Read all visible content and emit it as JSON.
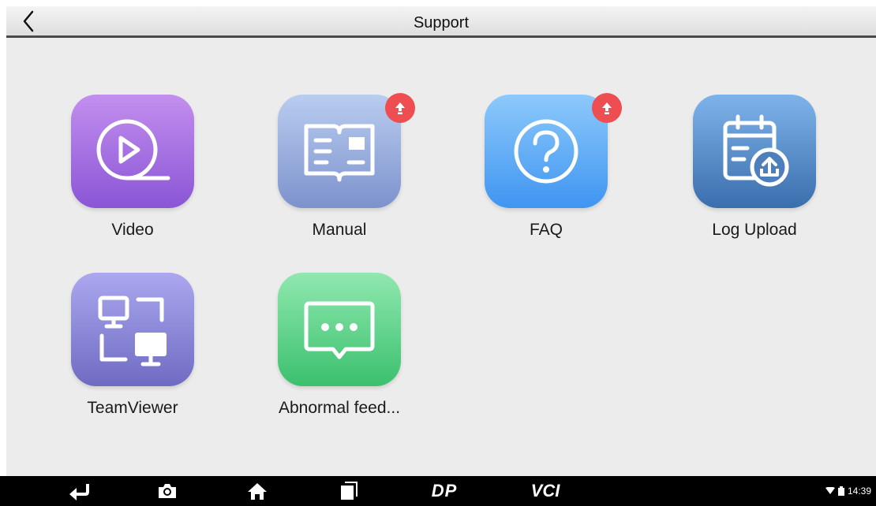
{
  "header": {
    "title": "Support",
    "back_icon": "chevron-left-icon"
  },
  "tiles": [
    {
      "label": "Video",
      "icon": "play-video-icon",
      "colors": [
        "#c38fee",
        "#8a55d6"
      ],
      "badge": false
    },
    {
      "label": "Manual",
      "icon": "manual-book-icon",
      "colors": [
        "#b9cdf0",
        "#7d92cc"
      ],
      "badge": true
    },
    {
      "label": "FAQ",
      "icon": "question-icon",
      "colors": [
        "#8dc9fb",
        "#3f95f1"
      ],
      "badge": true
    },
    {
      "label": "Log Upload",
      "icon": "log-upload-icon",
      "colors": [
        "#7eb3ea",
        "#3a6ead"
      ],
      "badge": false
    },
    {
      "label": "TeamViewer",
      "icon": "teamviewer-icon",
      "colors": [
        "#aba8ef",
        "#6f6bc2"
      ],
      "badge": false
    },
    {
      "label": "Abnormal feed...",
      "icon": "feedback-chat-icon",
      "colors": [
        "#90e8af",
        "#3bc06e"
      ],
      "badge": false
    }
  ],
  "badge": {
    "icon": "update-arrow-icon",
    "color": "#ee4d52"
  },
  "navbar": {
    "buttons": [
      "back-nav-icon",
      "camera-icon",
      "home-icon",
      "recents-icon",
      "dp-icon",
      "vci-icon"
    ],
    "dp_text": "DP",
    "vci_text": "VCI",
    "time": "14:39"
  }
}
